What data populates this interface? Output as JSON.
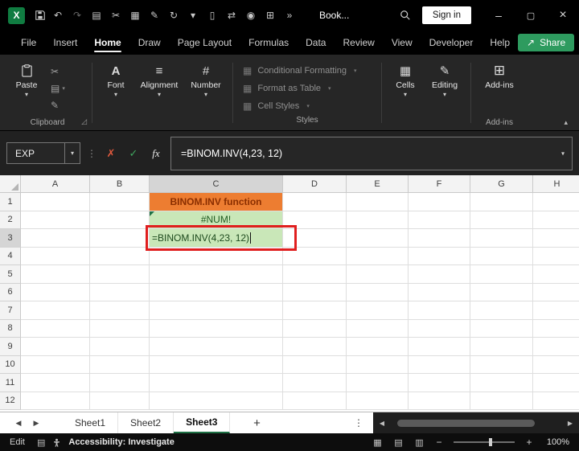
{
  "colors": {
    "accent_green": "#1E7145",
    "share_green": "#2E9B5F",
    "annotation_red": "#E01E1E",
    "active_tab_underline": "#F0F0F0"
  },
  "icons": {
    "logo_letter": "X",
    "chevron_down": "▾",
    "chevron_up": "▴",
    "minimize": "–",
    "restore": "▢",
    "close": "×",
    "dots_vertical": "⋮",
    "nav_left": "◀",
    "nav_right": "▶",
    "cancel": "✗",
    "enter": "✓",
    "fx": "fx",
    "dialog_launcher": "◿",
    "cut": "✂",
    "copy": "▤",
    "format_painter": "✎",
    "font": "A",
    "alignment": "≡",
    "number": "#",
    "cells": "▦",
    "editing": "✎",
    "addins": "⊞",
    "styles_item": "▦",
    "share": "↗",
    "macro": "▤",
    "view_normal": "▦",
    "view_layout": "▤",
    "view_break": "▥",
    "zoom_out": "−",
    "zoom_in": "+"
  },
  "titlebar": {
    "workbook_name": "Book...",
    "sign_in": "Sign in",
    "qat": [
      {
        "name": "undo-icon",
        "glyph": "↶",
        "dim": false
      },
      {
        "name": "redo-icon",
        "glyph": "↷",
        "dim": true
      },
      {
        "name": "clipboard-icon",
        "glyph": "▤",
        "dim": false
      },
      {
        "name": "cut-icon",
        "glyph": "✂",
        "dim": false
      },
      {
        "name": "chart-icon",
        "glyph": "▦",
        "dim": false
      },
      {
        "name": "format-painter-icon",
        "glyph": "✎",
        "dim": false
      },
      {
        "name": "refresh-icon",
        "glyph": "↻",
        "dim": false
      },
      {
        "name": "chevron-down-icon",
        "glyph": "▾",
        "dim": false
      },
      {
        "name": "document-icon",
        "glyph": "▯",
        "dim": false
      },
      {
        "name": "swap-icon",
        "glyph": "⇄",
        "dim": false
      },
      {
        "name": "camera-icon",
        "glyph": "◉",
        "dim": false
      },
      {
        "name": "table-icon",
        "glyph": "⊞",
        "dim": false
      },
      {
        "name": "more-commands-icon",
        "glyph": "»",
        "dim": false
      }
    ]
  },
  "menu": {
    "tabs": [
      "File",
      "Insert",
      "Home",
      "Draw",
      "Page Layout",
      "Formulas",
      "Data",
      "Review",
      "View",
      "Developer",
      "Help"
    ],
    "active_tab": "Home",
    "share_label": "Share"
  },
  "ribbon": {
    "paste_label": "Paste",
    "buttons": {
      "font": "Font",
      "alignment": "Alignment",
      "number": "Number",
      "cells": "Cells",
      "editing": "Editing",
      "addins": "Add-ins"
    },
    "styles_items": [
      "Conditional Formatting",
      "Format as Table",
      "Cell Styles"
    ],
    "groups": {
      "clipboard_label": "Clipboard",
      "styles_label": "Styles",
      "addins_group_label": "Add-ins"
    }
  },
  "formula_bar": {
    "name_box": "EXP",
    "formula": "=BINOM.INV(4,23, 12)"
  },
  "grid": {
    "columns": [
      {
        "label": "A",
        "width": 86
      },
      {
        "label": "B",
        "width": 74
      },
      {
        "label": "C",
        "width": 166
      },
      {
        "label": "D",
        "width": 79
      },
      {
        "label": "E",
        "width": 77
      },
      {
        "label": "F",
        "width": 77
      },
      {
        "label": "G",
        "width": 78
      },
      {
        "label": "H",
        "width": 60
      }
    ],
    "row_count": 12,
    "row_height": 22.5,
    "selected_column": "C",
    "selected_row": 3,
    "cells": {
      "C1": {
        "text": "BINOM.INV function",
        "bg": "#ED7D31",
        "color": "#8A2E00",
        "align": "center",
        "bold": true
      },
      "C2": {
        "text": "#NUM!",
        "bg": "#C9E7B8",
        "color": "#215C21",
        "align": "center",
        "error_flag": true
      },
      "C3": {
        "text": "=BINOM.INV(4,23, 12)",
        "bg": "#C9E7B8",
        "color": "#1D4A1D",
        "align": "left",
        "caret": true
      }
    },
    "annotation": {
      "color": "#E01E1E"
    }
  },
  "sheet_tabs": {
    "tabs": [
      "Sheet1",
      "Sheet2",
      "Sheet3"
    ],
    "active": "Sheet3",
    "add_label": "+"
  },
  "status_bar": {
    "mode": "Edit",
    "accessibility": "Accessibility: Investigate",
    "zoom": "100%"
  }
}
